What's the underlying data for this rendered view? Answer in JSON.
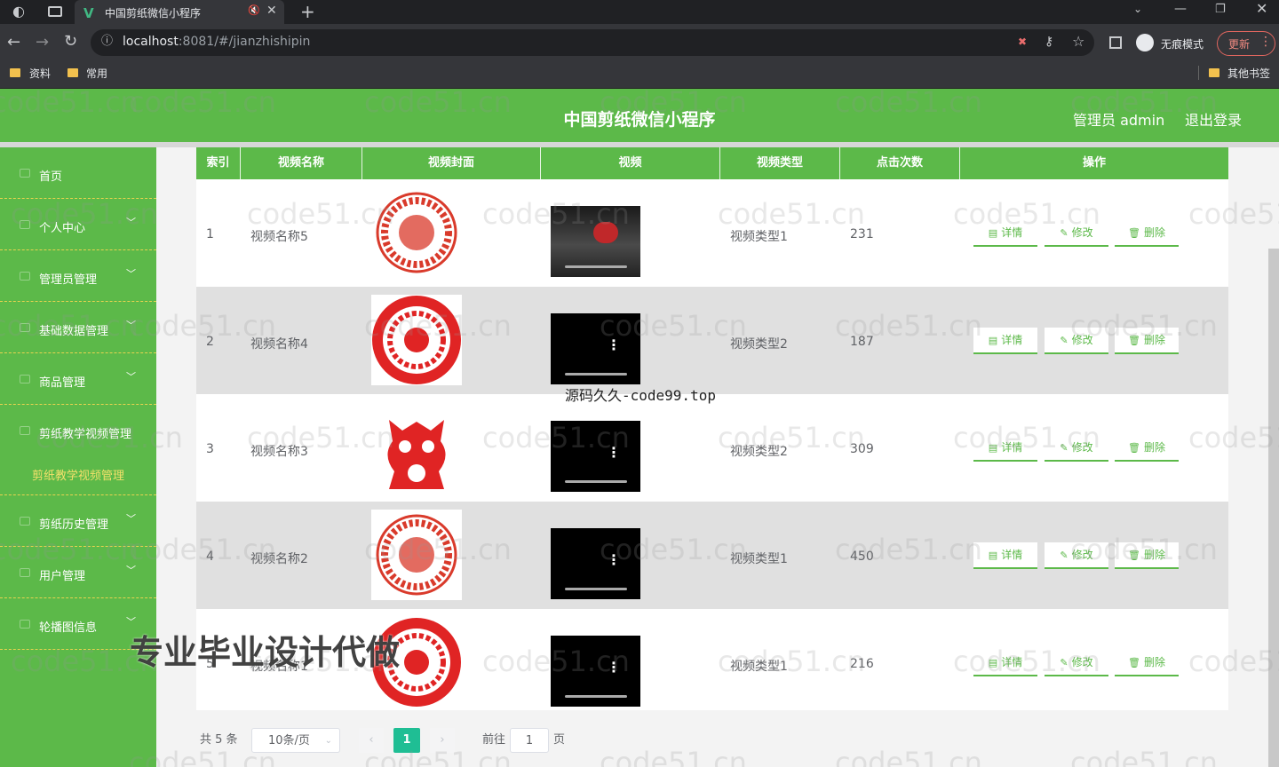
{
  "browser": {
    "tab_title": "中国剪纸微信小程序",
    "url_host": "localhost",
    "url_rest": ":8081/#/jianzhishipin",
    "incognito_label": "无痕模式",
    "update_label": "更新",
    "bookmarks": [
      "资料",
      "常用"
    ],
    "other_bookmarks": "其他书签"
  },
  "header": {
    "title": "中国剪纸微信小程序",
    "user_label": "管理员 admin",
    "logout_label": "退出登录"
  },
  "sidebar": {
    "items": [
      {
        "label": "首页",
        "chevron": false
      },
      {
        "label": "个人中心",
        "chevron": true
      },
      {
        "label": "管理员管理",
        "chevron": true
      },
      {
        "label": "基础数据管理",
        "chevron": true
      },
      {
        "label": "商品管理",
        "chevron": true
      },
      {
        "label": "剪纸教学视频管理",
        "chevron": false
      },
      {
        "label": "剪纸历史管理",
        "chevron": true
      },
      {
        "label": "用户管理",
        "chevron": true
      },
      {
        "label": "轮播图信息",
        "chevron": true
      }
    ],
    "sub_item": "剪纸教学视频管理"
  },
  "table": {
    "headers": [
      "索引",
      "视频名称",
      "视频封面",
      "视频",
      "视频类型",
      "点击次数",
      "操作"
    ],
    "rows": [
      {
        "index": "1",
        "name": "视频名称5",
        "type": "视频类型1",
        "clicks": "231"
      },
      {
        "index": "2",
        "name": "视频名称4",
        "type": "视频类型2",
        "clicks": "187"
      },
      {
        "index": "3",
        "name": "视频名称3",
        "type": "视频类型2",
        "clicks": "309"
      },
      {
        "index": "4",
        "name": "视频名称2",
        "type": "视频类型1",
        "clicks": "450"
      },
      {
        "index": "5",
        "name": "视频名称1",
        "type": "视频类型1",
        "clicks": "216"
      }
    ],
    "actions": {
      "detail": "详情",
      "edit": "修改",
      "delete": "删除"
    }
  },
  "pagination": {
    "total": "共 5 条",
    "page_size": "10条/页",
    "current_page": "1",
    "goto_label": "前往",
    "goto_value": "1",
    "page_unit": "页"
  },
  "overlays": {
    "watermark": "code51.cn",
    "source_text": "源码久久-code99.top",
    "ad_text": "专业毕业设计代做"
  },
  "colors": {
    "primary": "#5cb949",
    "accent": "#e8d34f",
    "paper_red": "#e02424"
  }
}
